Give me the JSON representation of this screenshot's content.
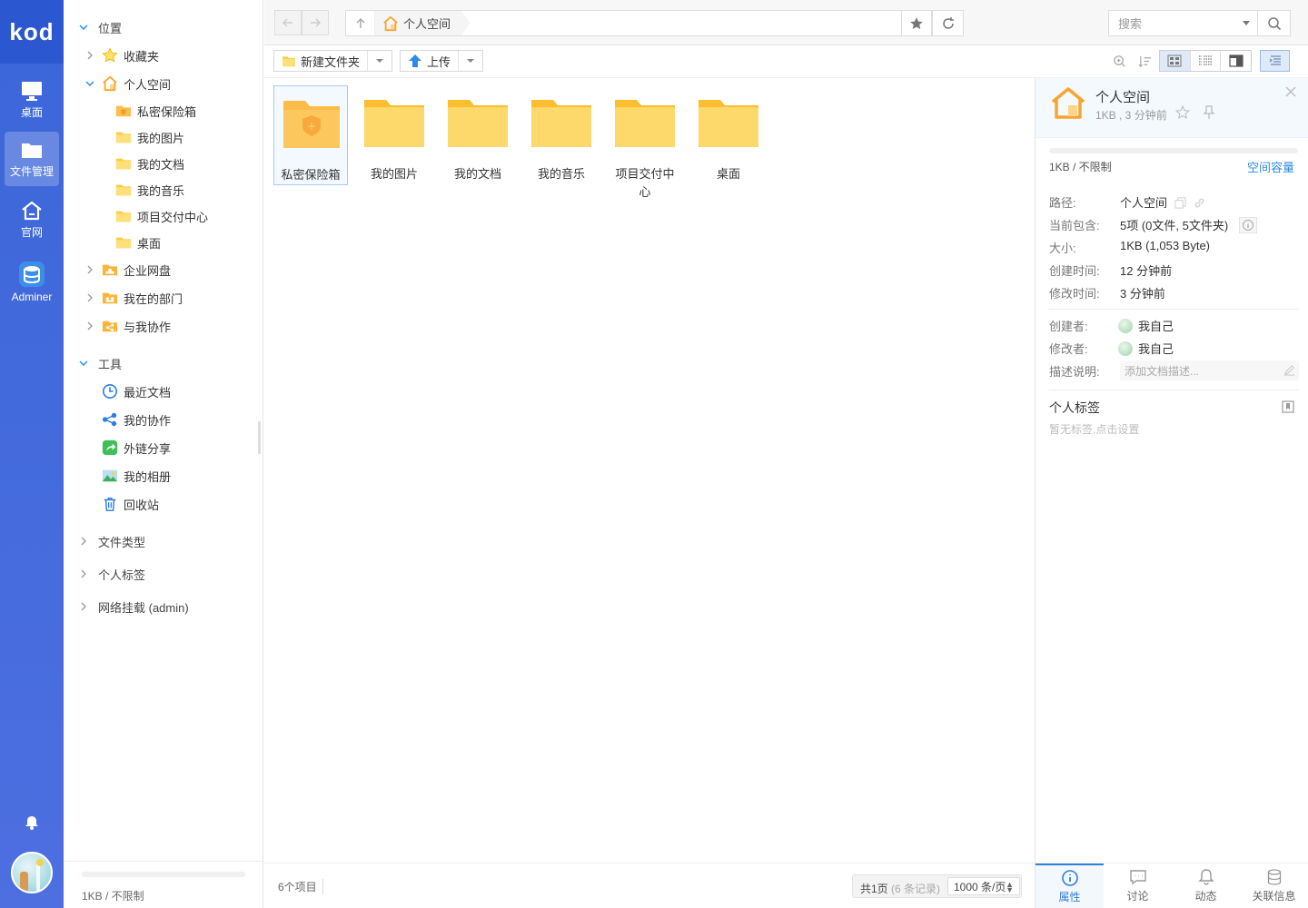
{
  "app": {
    "logo": "kod",
    "nav": [
      {
        "label": "桌面",
        "icon": "monitor-icon"
      },
      {
        "label": "文件管理",
        "icon": "folder-icon",
        "active": true
      },
      {
        "label": "官网",
        "icon": "home-icon"
      },
      {
        "label": "Adminer",
        "icon": "database-icon"
      }
    ]
  },
  "tree": {
    "location_header": "位置",
    "items": [
      {
        "label": "收藏夹",
        "icon": "star-icon"
      },
      {
        "label": "个人空间",
        "icon": "home-icon"
      },
      {
        "label": "私密保险箱",
        "icon": "folder-safe-icon"
      },
      {
        "label": "我的图片",
        "icon": "folder-icon"
      },
      {
        "label": "我的文档",
        "icon": "folder-icon"
      },
      {
        "label": "我的音乐",
        "icon": "folder-icon"
      },
      {
        "label": "项目交付中心",
        "icon": "folder-icon"
      },
      {
        "label": "桌面",
        "icon": "folder-icon"
      },
      {
        "label": "企业网盘",
        "icon": "folder-org-icon"
      },
      {
        "label": "我在的部门",
        "icon": "folder-dept-icon"
      },
      {
        "label": "与我协作",
        "icon": "folder-share-icon"
      }
    ],
    "tools_header": "工具",
    "tools": [
      {
        "label": "最近文档",
        "icon": "clock-icon"
      },
      {
        "label": "我的协作",
        "icon": "share-nodes-icon"
      },
      {
        "label": "外链分享",
        "icon": "share-link-icon"
      },
      {
        "label": "我的相册",
        "icon": "photo-icon"
      },
      {
        "label": "回收站",
        "icon": "trash-icon"
      }
    ],
    "sections": [
      "文件类型",
      "个人标签",
      "网络挂载 (admin)"
    ],
    "footer_usage": "1KB / 不限制"
  },
  "topbar": {
    "crumb": "个人空间",
    "search_placeholder": "搜索"
  },
  "toolbar": {
    "new_folder": "新建文件夹",
    "upload": "上传"
  },
  "files": [
    {
      "name": "私密保险箱",
      "type": "safe"
    },
    {
      "name": "我的图片",
      "type": "folder"
    },
    {
      "name": "我的文档",
      "type": "folder"
    },
    {
      "name": "我的音乐",
      "type": "folder"
    },
    {
      "name": "项目交付中心",
      "type": "folder"
    },
    {
      "name": "桌面",
      "type": "folder"
    }
  ],
  "status": {
    "count": "6个项目",
    "pages": "共1页",
    "records": "(6 条记录)",
    "page_size": "1000 条/页"
  },
  "panel": {
    "title": "个人空间",
    "subtitle": "1KB , 3 分钟前",
    "usage": "1KB / 不限制",
    "capacity_link": "空间容量",
    "props": [
      {
        "key": "路径:",
        "value": "个人空间"
      },
      {
        "key": "当前包含:",
        "value": "5项 (0文件, 5文件夹)"
      },
      {
        "key": "大小:",
        "value": "1KB (1,053 Byte)"
      },
      {
        "key": "创建时间:",
        "value": "12 分钟前"
      },
      {
        "key": "修改时间:",
        "value": "3 分钟前"
      }
    ],
    "people": [
      {
        "key": "创建者:",
        "value": "我自己"
      },
      {
        "key": "修改者:",
        "value": "我自己"
      }
    ],
    "desc_key": "描述说明:",
    "desc_placeholder": "添加文档描述...",
    "tag_title": "个人标签",
    "tag_empty": "暂无标签,点击设置",
    "tabs": [
      {
        "label": "属性",
        "active": true
      },
      {
        "label": "讨论"
      },
      {
        "label": "动态"
      },
      {
        "label": "关联信息"
      }
    ]
  },
  "colors": {
    "rail": "#3b66d9",
    "accent": "#2d8ae8",
    "folder": "#fcc934"
  }
}
